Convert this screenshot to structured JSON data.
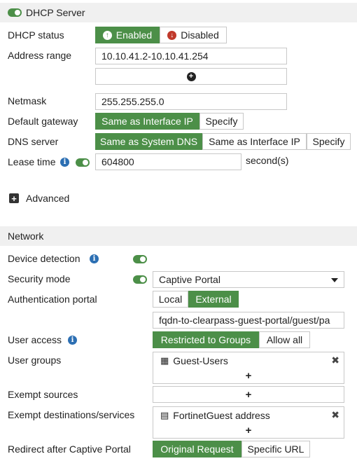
{
  "dhcp": {
    "header": "DHCP Server",
    "status_label": "DHCP status",
    "status_enabled": "Enabled",
    "status_disabled": "Disabled",
    "address_range_label": "Address range",
    "address_range_value": "10.10.41.2-10.10.41.254",
    "netmask_label": "Netmask",
    "netmask_value": "255.255.255.0",
    "gateway_label": "Default gateway",
    "gateway_options": [
      "Same as Interface IP",
      "Specify"
    ],
    "dns_label": "DNS server",
    "dns_options": [
      "Same as System DNS",
      "Same as Interface IP",
      "Specify"
    ],
    "lease_label": "Lease time",
    "lease_value": "604800",
    "lease_unit": "second(s)",
    "advanced_label": "Advanced"
  },
  "network": {
    "header": "Network",
    "device_detection_label": "Device detection",
    "security_mode_label": "Security mode",
    "security_mode_value": "Captive Portal",
    "auth_portal_label": "Authentication portal",
    "auth_portal_options": [
      "Local",
      "External"
    ],
    "auth_portal_url": "fqdn-to-clearpass-guest-portal/guest/pa",
    "user_access_label": "User access",
    "user_access_options": [
      "Restricted to Groups",
      "Allow all"
    ],
    "user_groups_label": "User groups",
    "user_groups_entry": "Guest-Users",
    "exempt_sources_label": "Exempt sources",
    "exempt_dest_label": "Exempt destinations/services",
    "exempt_dest_entry": "FortinetGuest address",
    "redirect_label": "Redirect after Captive Portal",
    "redirect_options": [
      "Original Request",
      "Specific URL"
    ]
  },
  "colors": {
    "accent_green": "#4c8f48",
    "info_blue": "#2c6fb3"
  }
}
